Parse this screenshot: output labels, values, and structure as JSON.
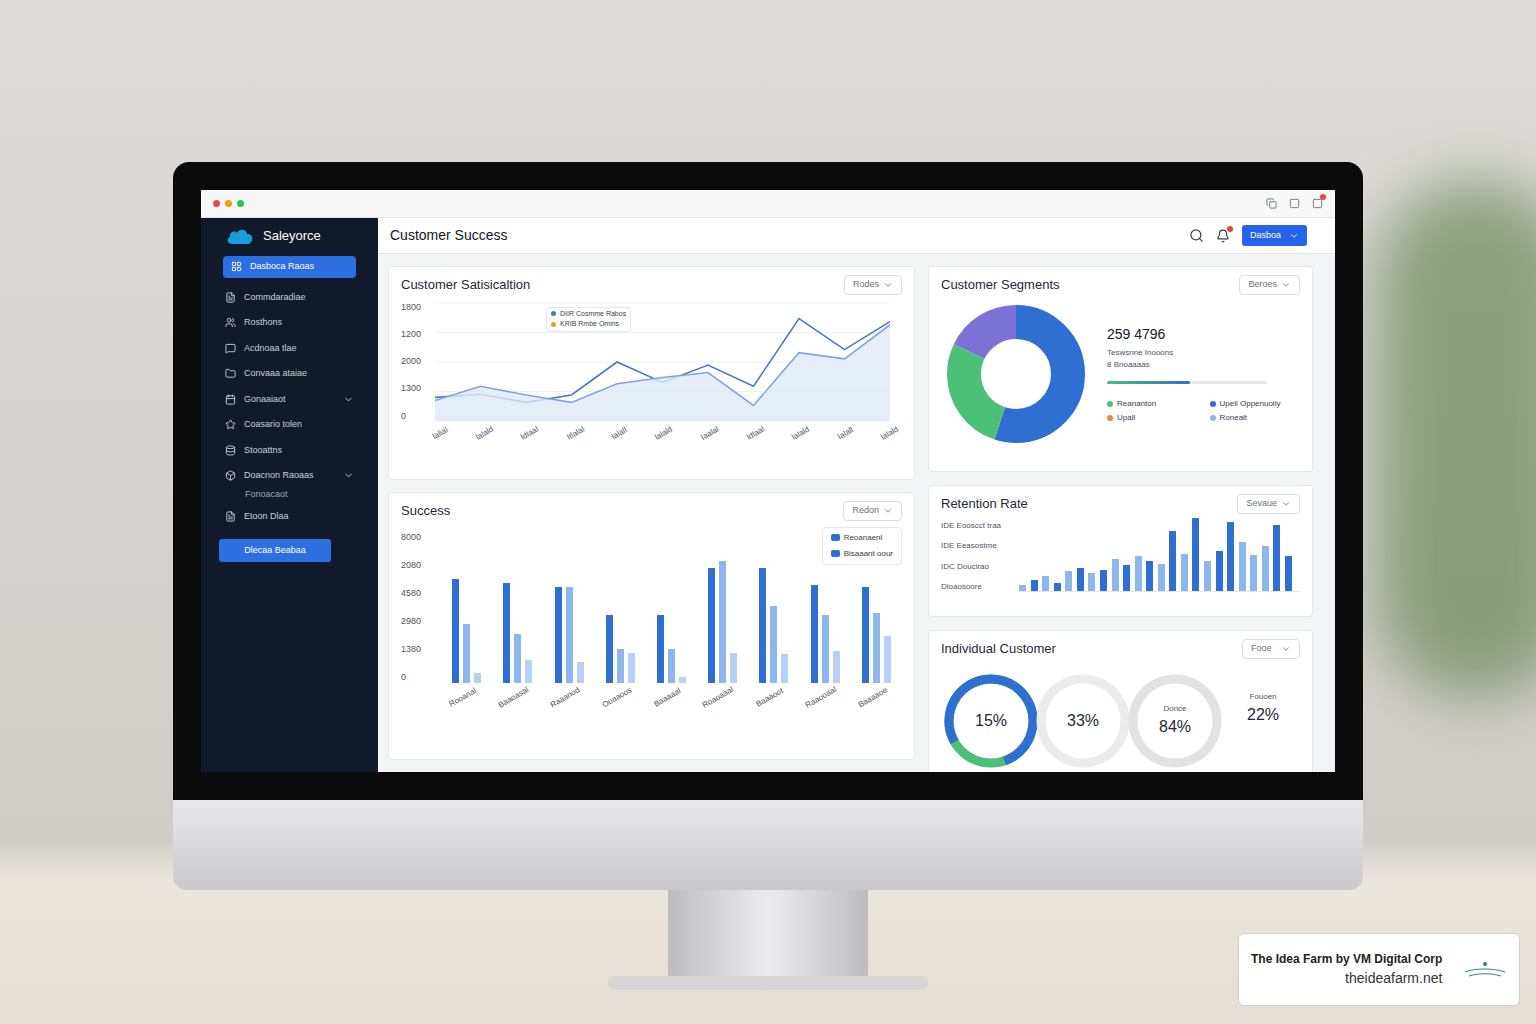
{
  "window": {
    "dots": [
      {
        "color": "#ef4444"
      },
      {
        "color": "#f59e0b"
      },
      {
        "color": "#22c55e"
      }
    ],
    "notification": true
  },
  "brand": {
    "name": "Saleyorce"
  },
  "sidebar": {
    "items": [
      {
        "label": "Dasboca Raoas",
        "selected": true,
        "kind": "item",
        "chevron": false
      },
      {
        "label": "Commdaradiae",
        "selected": false,
        "kind": "item",
        "chevron": false
      },
      {
        "label": "Rosthons",
        "selected": false,
        "kind": "item",
        "chevron": false
      },
      {
        "label": "Acdnoaa tlae",
        "selected": false,
        "kind": "item",
        "chevron": false
      },
      {
        "label": "Convaaa ataiae",
        "selected": false,
        "kind": "item",
        "chevron": false
      },
      {
        "label": "Gonaaiaot",
        "selected": false,
        "kind": "item",
        "chevron": true
      },
      {
        "label": "Coasario tolen",
        "selected": false,
        "kind": "item",
        "chevron": false
      },
      {
        "label": "Stooattns",
        "selected": false,
        "kind": "item",
        "chevron": false
      },
      {
        "label": "Doacnon Raoaas",
        "selected": false,
        "kind": "item",
        "chevron": true
      },
      {
        "label": "Fonoacaot",
        "selected": false,
        "kind": "sub",
        "chevron": false
      },
      {
        "label": "Etoon Dlaa",
        "selected": false,
        "kind": "item",
        "chevron": false
      }
    ],
    "button": "Dlecaa Beabaa"
  },
  "header": {
    "title": "Customer Success",
    "button": "Dasboa"
  },
  "satisfaction": {
    "title": "Customer Satisicaltion",
    "dropdown": "Rodes",
    "y_ticks": [
      "1800",
      "1200",
      "2000",
      "1300",
      "0"
    ],
    "x_labels": [
      "lalial",
      "lalald",
      "ldlaal",
      "Itlalal",
      "lalall",
      "lalald",
      "Iaalal",
      "ldlaal",
      "lalald",
      "Ialall",
      "lalald"
    ],
    "legend": [
      {
        "label": "DIIR  Cosmme Rabos",
        "color": "#4a78c8"
      },
      {
        "label": "KRIB  Rmbe  Omins",
        "color": "#f59e0b"
      }
    ],
    "series": [
      {
        "color": "#4a78c8",
        "fill": false,
        "values": [
          380,
          430,
          300,
          420,
          950,
          620,
          900,
          560,
          1650,
          1150,
          1600
        ]
      },
      {
        "color": "#7fa6dc",
        "fill": true,
        "values": [
          330,
          560,
          420,
          300,
          600,
          700,
          780,
          250,
          1100,
          1000,
          1550
        ]
      }
    ]
  },
  "segments": {
    "title": "Customer Segments",
    "dropdown": "Beroes",
    "total": "259 4796",
    "caption": "Teswsnne Inooons",
    "sub": "8 Bnoaaaas",
    "level": 0.52,
    "slices": [
      {
        "level": 0.55,
        "color": "#2f6fd1"
      },
      {
        "level": 0.27,
        "color": "#4cbf78"
      },
      {
        "level": 0.18,
        "color": "#7c72d6"
      }
    ],
    "legend": [
      {
        "label": "Reananton",
        "color": "#4cbf78"
      },
      {
        "label": "Upell Oppenuoily",
        "color": "#2f6fd1"
      },
      {
        "label": "Upall",
        "color": "#f08a35"
      },
      {
        "label": "Ronealt",
        "color": "#8db7ea"
      }
    ]
  },
  "success": {
    "title": "Success",
    "dropdown": "Redon",
    "y_ticks": [
      "8000",
      "2080",
      "4580",
      "2980",
      "1380",
      "0"
    ],
    "legend": [
      {
        "label": "Reoanaenl",
        "color": "#2f6fd1"
      },
      {
        "label": "Bisaaant oour",
        "color": "#2f6fd1"
      }
    ],
    "colors": [
      "#2f6fd1",
      "#8db7ea",
      "#b5d0f2"
    ],
    "groups": [
      {
        "label": "Rooanal",
        "values": [
          5500,
          3100,
          500
        ]
      },
      {
        "label": "Baaoasal",
        "values": [
          5300,
          2600,
          1200
        ]
      },
      {
        "label": "Raaanod",
        "values": [
          5100,
          5100,
          1100
        ]
      },
      {
        "label": "Ooaaoos",
        "values": [
          3600,
          1800,
          1550
        ]
      },
      {
        "label": "Baaaaal",
        "values": [
          3600,
          1800,
          300
        ]
      },
      {
        "label": "Roaoaaal",
        "values": [
          6100,
          6500,
          1600
        ]
      },
      {
        "label": "Baaaoot",
        "values": [
          6100,
          4100,
          1500
        ]
      },
      {
        "label": "Raaooaal",
        "values": [
          5200,
          3600,
          1700
        ]
      },
      {
        "label": "Baaaaoe",
        "values": [
          5100,
          3700,
          2500
        ]
      }
    ]
  },
  "retention": {
    "title": "Retention Rate",
    "dropdown": "Sevaue",
    "labels": [
      "IDE Eooscct traa",
      "IDE Eeasostme",
      "IDC Doucirao",
      "Dloaosoore"
    ],
    "bars": [
      {
        "value": 8,
        "color": "#8db7ea"
      },
      {
        "value": 14,
        "color": "#2f6fd1"
      },
      {
        "value": 20,
        "color": "#8db7ea"
      },
      {
        "value": 10,
        "color": "#2f6fd1"
      },
      {
        "value": 26,
        "color": "#8db7ea"
      },
      {
        "value": 30,
        "color": "#2f6fd1"
      },
      {
        "value": 24,
        "color": "#8db7ea"
      },
      {
        "value": 28,
        "color": "#2f6fd1"
      },
      {
        "value": 42,
        "color": "#8db7ea"
      },
      {
        "value": 34,
        "color": "#2f6fd1"
      },
      {
        "value": 46,
        "color": "#8db7ea"
      },
      {
        "value": 40,
        "color": "#2f6fd1"
      },
      {
        "value": 36,
        "color": "#8db7ea"
      },
      {
        "value": 80,
        "color": "#2f6fd1"
      },
      {
        "value": 50,
        "color": "#8db7ea"
      },
      {
        "value": 98,
        "color": "#2f6fd1"
      },
      {
        "value": 40,
        "color": "#8db7ea"
      },
      {
        "value": 54,
        "color": "#2f6fd1"
      },
      {
        "value": 92,
        "color": "#2f6fd1"
      },
      {
        "value": 66,
        "color": "#8db7ea"
      },
      {
        "value": 48,
        "color": "#8db7ea"
      },
      {
        "value": 60,
        "color": "#8db7ea"
      },
      {
        "value": 88,
        "color": "#2f6fd1"
      },
      {
        "value": 46,
        "color": "#2f6fd1"
      }
    ]
  },
  "individual": {
    "title": "Individual Customer",
    "dropdown": "Fooe",
    "items": [
      {
        "kind": "ring",
        "label": "",
        "value": "15%",
        "level": 0.78,
        "color": "#2f6fd1",
        "track": "#4cbf78"
      },
      {
        "kind": "ring",
        "label": "",
        "value": "33%",
        "level": 0,
        "color": "#2f6fd1",
        "track": "#ececec"
      },
      {
        "kind": "ring",
        "label": "Donce",
        "value": "84%",
        "level": 0,
        "color": "#2f6fd1",
        "track": "#e2e2e2"
      },
      {
        "kind": "plain",
        "label": "Fouoen",
        "value": "22%",
        "level": 0,
        "color": "#2f6fd1",
        "track": "#ffffff"
      }
    ]
  },
  "watermark": {
    "title": "The Idea Farm by VM Digital Corp",
    "url": "theideafarm.net"
  }
}
